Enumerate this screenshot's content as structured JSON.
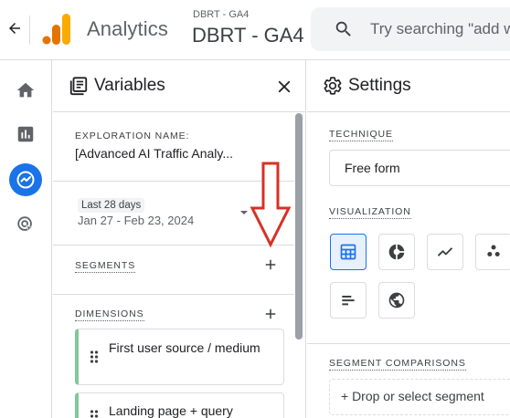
{
  "header": {
    "app_title": "Analytics",
    "account_small": "DBRT - GA4",
    "account_big": "DBRT - GA4",
    "search_placeholder": "Try searching \"add w"
  },
  "rail": {
    "items": [
      {
        "icon": "home-icon"
      },
      {
        "icon": "reports-icon"
      },
      {
        "icon": "explore-icon",
        "active": true
      },
      {
        "icon": "advertising-icon"
      }
    ]
  },
  "variables": {
    "title": "Variables",
    "exploration_name_label": "EXPLORATION NAME:",
    "exploration_name_value": "[Advanced AI Traffic Analy...",
    "date_chip": "Last 28 days",
    "date_range": "Jan 27 - Feb 23, 2024",
    "segments_label": "SEGMENTS",
    "dimensions_label": "DIMENSIONS",
    "dimensions": [
      {
        "label": "First user source / medium"
      },
      {
        "label": "Landing page + query"
      }
    ]
  },
  "settings": {
    "title": "Settings",
    "technique_label": "TECHNIQUE",
    "technique_value": "Free form",
    "visualization_label": "VISUALIZATION",
    "visualizations": [
      "table-icon",
      "donut-chart-icon",
      "line-chart-icon",
      "scatter-chart-icon",
      "bar-chart-icon",
      "geo-map-icon"
    ],
    "segment_comparisons_label": "SEGMENT COMPARISONS",
    "drop_segment_text": "+ Drop or select segment"
  },
  "colors": {
    "accent": "#1a73e8",
    "annotation_arrow": "#d93025",
    "dimension_stripe": "#81c995"
  }
}
